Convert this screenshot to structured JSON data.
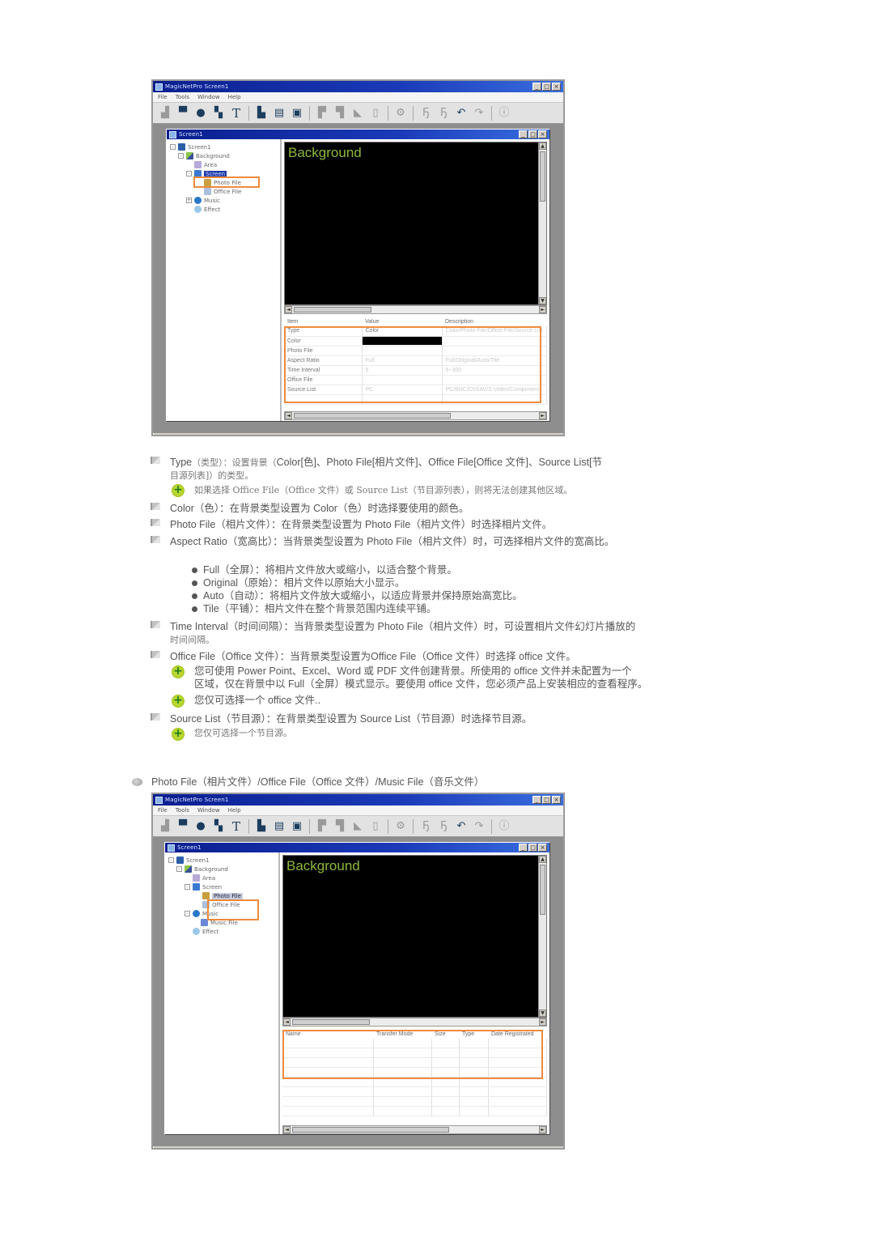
{
  "screens": [
    {
      "window_title": "MagicNetPro Screen1",
      "menu": [
        "File",
        "Tools",
        "Window",
        "Help"
      ],
      "toolbar_icons": [
        "delete-icon",
        "screen-icon",
        "network-icon",
        "monitor-copy-icon",
        "text-icon",
        "open-folder-icon",
        "save-icon",
        "image-icon",
        "align-top-icon",
        "align-bottom-icon",
        "link-icon",
        "trash-icon",
        "settings-icon",
        "bring-front-icon",
        "send-back-icon",
        "undo-icon",
        "redo-icon",
        "info-icon"
      ],
      "child_title": "Screen1",
      "tree": [
        {
          "label": "Screen1",
          "level": 0,
          "expander": "-"
        },
        {
          "label": "Background",
          "level": 1,
          "expander": "-"
        },
        {
          "label": "Area",
          "level": 2,
          "expander": ""
        },
        {
          "label": "Screen",
          "level": 2,
          "expander": "-",
          "selected": true
        },
        {
          "label": "Photo File",
          "level": 3,
          "expander": ""
        },
        {
          "label": "Office File",
          "level": 3,
          "expander": ""
        },
        {
          "label": "Music",
          "level": 1,
          "expander": "+"
        },
        {
          "label": "Effect",
          "level": 1,
          "expander": ""
        }
      ],
      "preview_title": "Background",
      "properties": {
        "columns": [
          "Item",
          "Value",
          "Description"
        ],
        "rows": [
          {
            "item": "Type",
            "value": "Color",
            "description": "Color/Photo File/Office File/Source List"
          },
          {
            "item": "Color",
            "value": "#000000",
            "description": ""
          },
          {
            "item": "Photo File",
            "value": "",
            "description": ""
          },
          {
            "item": "Aspect Ratio",
            "value": "Full",
            "description": "Full/Original/Auto/Tile"
          },
          {
            "item": "Time Interval",
            "value": "5",
            "description": "5~300"
          },
          {
            "item": "Office File",
            "value": "",
            "description": ""
          },
          {
            "item": "Source List",
            "value": "PC",
            "description": "PC/BNC/DVI/AV/S-Video/Component"
          }
        ]
      }
    },
    {
      "window_title": "MagicNetPro Screen1",
      "menu": [
        "File",
        "Tools",
        "Window",
        "Help"
      ],
      "child_title": "Screen1",
      "tree": [
        {
          "label": "Screen1",
          "level": 0,
          "expander": "-"
        },
        {
          "label": "Background",
          "level": 1,
          "expander": "-"
        },
        {
          "label": "Area",
          "level": 2,
          "expander": ""
        },
        {
          "label": "Screen",
          "level": 2,
          "expander": "-"
        },
        {
          "label": "Photo File",
          "level": 3,
          "expander": "",
          "selected": true
        },
        {
          "label": "Office File",
          "level": 3,
          "expander": ""
        },
        {
          "label": "Music",
          "level": 1,
          "expander": "-"
        },
        {
          "label": "Music File",
          "level": 2,
          "expander": ""
        },
        {
          "label": "Effect",
          "level": 1,
          "expander": ""
        }
      ],
      "preview_title": "Background",
      "file_list": {
        "columns": [
          "Name",
          "Transfer Mode",
          "Size",
          "Type",
          "Date Registrated"
        ]
      }
    }
  ],
  "doc": {
    "type_en": "Type",
    "type_cn": "（类型）：设置背景（",
    "type_line1_rest": "Color[色]、Photo File[相片文件]、Office File[Office 文件]、Source List[节",
    "type_line2": "目源列表]）的类型。",
    "type_tip": "如果选择 Office File（Office 文件）或 Source List（节目源列表），则将无法创建其他区域。",
    "color_line": "Color（色）：在背景类型设置为 Color（色）时选择要使用的颜色。",
    "photo_line": "Photo File（相片文件）：在背景类型设置为 Photo File（相片文件）时选择相片文件。",
    "aspect_line": "Aspect Ratio（宽高比）：当背景类型设置为 Photo File（相片文件）时，可选择相片文件的宽高比。",
    "aspect_options": [
      "Full（全屏）：将相片文件放大或缩小，以适合整个背景。",
      "Original（原始）：相片文件以原始大小显示。",
      "Auto（自动）：将相片文件放大或缩小，以适应背景并保持原始高宽比。",
      "Tile（平铺）：相片文件在整个背景范围内连续平铺。"
    ],
    "interval_line1": "Time Interval（时间间隔）：当背景类型设置为 Photo File（相片文件）时，可设置相片文件幻灯片播放的",
    "interval_line2": "时间间隔。",
    "office_line": "Office File（Office 文件）：当背景类型设置为Office File（Office 文件）时选择 office 文件。",
    "office_tip1_line1": "您可使用 Power Point、Excel、Word 或 PDF 文件创建背景。所使用的 office 文件并未配置为一个",
    "office_tip1_line2": "区域，仅在背景中以 Full（全屏）模式显示。要使用 office 文件，您必须产品上安装相应的查看程序。",
    "office_tip2": "您仅可选择一个 office 文件..",
    "source_line": "Source List（节目源）：在背景类型设置为 Source List（节目源）时选择节目源。",
    "source_tip": "您仅可选择一个节目源。",
    "section2_heading": "Photo File（相片文件）/Office File（Office 文件）/Music File（音乐文件）"
  }
}
